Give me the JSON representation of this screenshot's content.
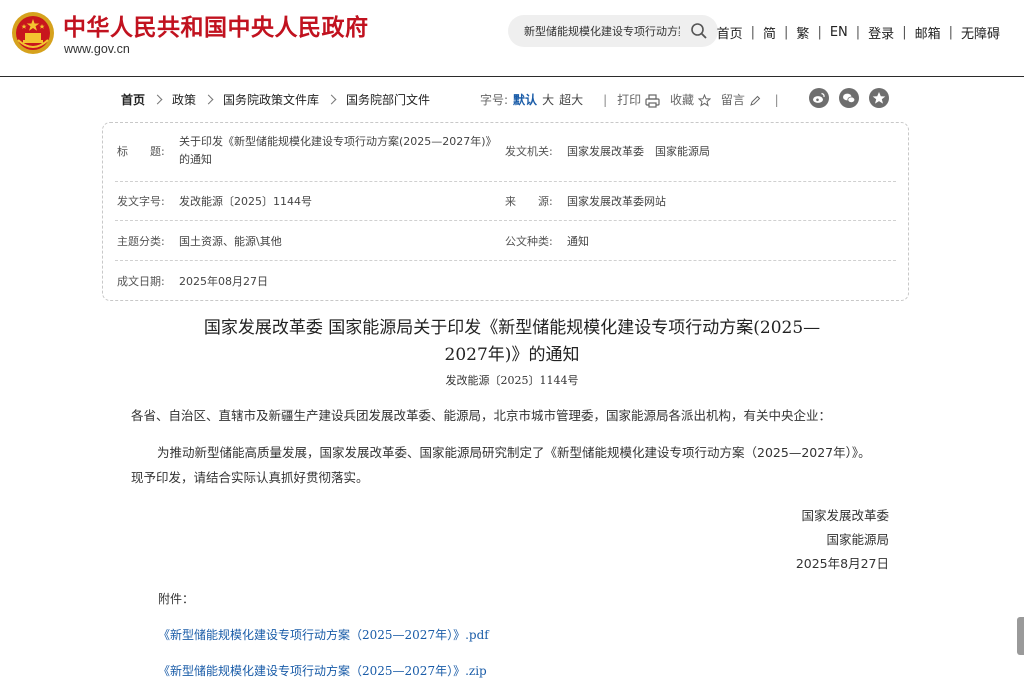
{
  "header": {
    "site_title": "中华人民共和国中央人民政府",
    "site_url": "www.gov.cn",
    "search_value": "新型储能规模化建设专项行动方案",
    "nav": [
      "首页",
      "简",
      "繁",
      "EN",
      "登录",
      "邮箱",
      "无障碍"
    ]
  },
  "breadcrumb": [
    "首页",
    "政策",
    "国务院政策文件库",
    "国务院部门文件"
  ],
  "tools": {
    "font_size_label": "字号:",
    "sizes": [
      "默认",
      "大",
      "超大"
    ],
    "print": "打印",
    "favorite": "收藏",
    "comment": "留言"
  },
  "meta": {
    "title_label": "标　　题:",
    "title_value": "关于印发《新型储能规模化建设专项行动方案(2025—2027年)》的通知",
    "issuer_label": "发文机关:",
    "issuer_value": "国家发展改革委　国家能源局",
    "docno_label": "发文字号:",
    "docno_value": "发改能源〔2025〕1144号",
    "source_label": "来　　源:",
    "source_value": "国家发展改革委网站",
    "category_label": "主题分类:",
    "category_value": "国土资源、能源\\其他",
    "type_label": "公文种类:",
    "type_value": "通知",
    "date_label": "成文日期:",
    "date_value": "2025年08月27日"
  },
  "article": {
    "title_line1": "国家发展改革委 国家能源局关于印发《新型储能规模化建设专项行动方案(2025—",
    "title_line2": "2027年)》的通知",
    "doc_number": "发改能源〔2025〕1144号",
    "recipients": "各省、自治区、直辖市及新疆生产建设兵团发展改革委、能源局，北京市城市管理委，国家能源局各派出机构，有关中央企业：",
    "paragraph": "为推动新型储能高质量发展，国家发展改革委、国家能源局研究制定了《新型储能规模化建设专项行动方案（2025—2027年）》。现予印发，请结合实际认真抓好贯彻落实。",
    "signature": [
      "国家发展改革委",
      "国家能源局",
      "2025年8月27日"
    ],
    "attachments_label": "附件：",
    "attachments": [
      "《新型储能规模化建设专项行动方案（2025—2027年）》.pdf",
      "《新型储能规模化建设专项行动方案（2025—2027年）》.zip"
    ]
  },
  "colors": {
    "brand_red": "#c1121f",
    "link_blue": "#1a5ca8",
    "icon_gray": "#6e6e6e"
  }
}
